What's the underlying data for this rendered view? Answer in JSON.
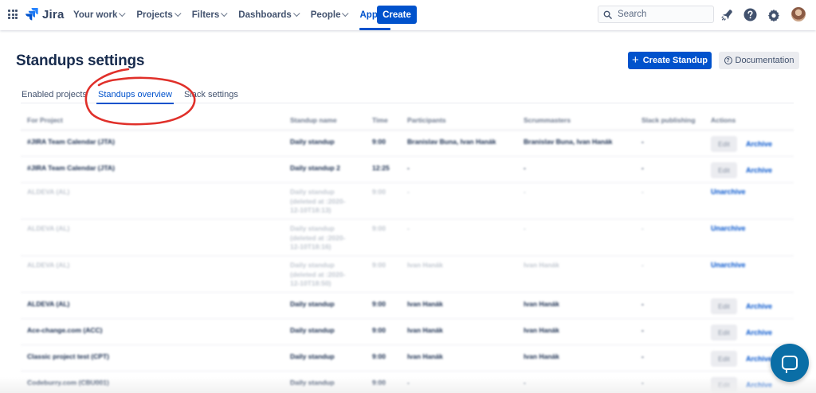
{
  "topnav": {
    "logo_text": "Jira",
    "menu": [
      {
        "label": "Your work",
        "active": false
      },
      {
        "label": "Projects",
        "active": false
      },
      {
        "label": "Filters",
        "active": false
      },
      {
        "label": "Dashboards",
        "active": false
      },
      {
        "label": "People",
        "active": false
      },
      {
        "label": "Apps",
        "active": true
      }
    ],
    "create_label": "Create",
    "search_placeholder": "Search",
    "icons": [
      "notifications-icon",
      "help-icon",
      "settings-icon"
    ]
  },
  "page": {
    "title": "Standups settings",
    "create_standup_label": "Create Standup",
    "documentation_label": "Documentation"
  },
  "tabs": [
    {
      "label": "Enabled projects",
      "active": false
    },
    {
      "label": "Standups overview",
      "active": true
    },
    {
      "label": "Slack settings",
      "active": false
    }
  ],
  "table": {
    "headers": [
      "For Project",
      "Standup name",
      "Time",
      "Participants",
      "Scrummasters",
      "Slack publishing",
      "Actions"
    ],
    "edit_label": "Edit",
    "archive_label": "Archive",
    "unarchive_label": "Unarchive",
    "rows": [
      {
        "project": "#JIRA Team Calendar (JTA)",
        "name": [
          "Daily standup"
        ],
        "time": "9:00",
        "participants": "Branislav Buna, Ivan Hanák",
        "scrummasters": "Branislav Buna, Ivan Hanák",
        "slack": "-",
        "archived": false
      },
      {
        "project": "#JIRA Team Calendar (JTA)",
        "name": [
          "Daily standup 2"
        ],
        "time": "12:25",
        "participants": "-",
        "scrummasters": "-",
        "slack": "-",
        "archived": false
      },
      {
        "project": "ALDEVA (AL)",
        "name": [
          "Daily standup",
          "(deleted at :2020-",
          "12-10T18:13)"
        ],
        "time": "9:00",
        "participants": "-",
        "scrummasters": "-",
        "slack": "-",
        "archived": true
      },
      {
        "project": "ALDEVA (AL)",
        "name": [
          "Daily standup",
          "(deleted at :2020-",
          "12-10T18:16)"
        ],
        "time": "9:00",
        "participants": "-",
        "scrummasters": "-",
        "slack": "-",
        "archived": true
      },
      {
        "project": "ALDEVA (AL)",
        "name": [
          "Daily standup",
          "(deleted at :2020-",
          "12-10T18:50)"
        ],
        "time": "9:00",
        "participants": "Ivan Hanák",
        "scrummasters": "Ivan Hanák",
        "slack": "-",
        "archived": true
      },
      {
        "project": "ALDEVA (AL)",
        "name": [
          "Daily standup"
        ],
        "time": "9:00",
        "participants": "Ivan Hanák",
        "scrummasters": "Ivan Hanák",
        "slack": "-",
        "archived": false
      },
      {
        "project": "Ace-change.com (ACC)",
        "name": [
          "Daily standup"
        ],
        "time": "9:00",
        "participants": "Ivan Hanák",
        "scrummasters": "Ivan Hanák",
        "slack": "-",
        "archived": false
      },
      {
        "project": "Classic project test (CPT)",
        "name": [
          "Daily standup"
        ],
        "time": "9:00",
        "participants": "Ivan Hanák",
        "scrummasters": "Ivan Hanák",
        "slack": "-",
        "archived": false
      },
      {
        "project": "Codeburry.com (CBU001)",
        "name": [
          "Daily standup"
        ],
        "time": "9:00",
        "participants": "-",
        "scrummasters": "-",
        "slack": "-",
        "archived": false
      }
    ]
  },
  "colors": {
    "brand": "#0052cc",
    "annotation": "#e0302a",
    "chat": "#0a6ea6"
  }
}
